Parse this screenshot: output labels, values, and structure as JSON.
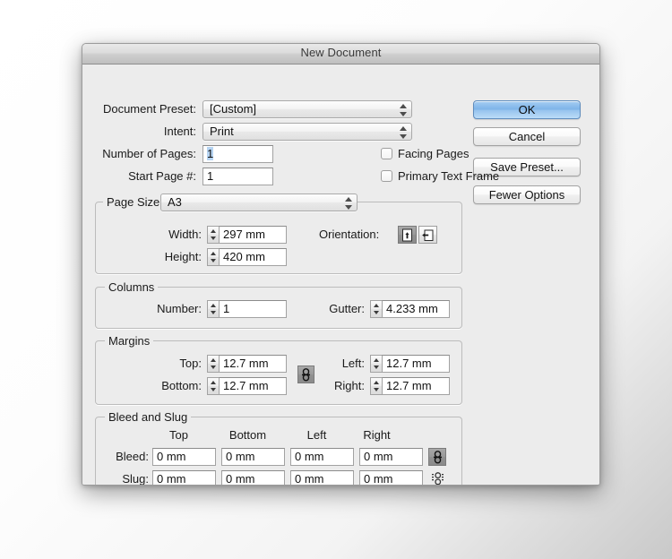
{
  "window": {
    "title": "New Document"
  },
  "buttons": {
    "ok": "OK",
    "cancel": "Cancel",
    "save_preset": "Save Preset...",
    "fewer_options": "Fewer Options"
  },
  "top_fields": {
    "document_preset_label": "Document Preset:",
    "document_preset_value": "[Custom]",
    "intent_label": "Intent:",
    "intent_value": "Print",
    "number_of_pages_label": "Number of Pages:",
    "number_of_pages_value": "1",
    "start_page_label": "Start Page #:",
    "start_page_value": "1",
    "facing_pages_label": "Facing Pages",
    "facing_pages_checked": false,
    "primary_text_frame_label": "Primary Text Frame",
    "primary_text_frame_checked": false
  },
  "page_size": {
    "group_label": "Page Size:",
    "value": "A3",
    "width_label": "Width:",
    "width_value": "297 mm",
    "height_label": "Height:",
    "height_value": "420 mm",
    "orientation_label": "Orientation:",
    "orientation_portrait_icon": "portrait-orientation-icon",
    "orientation_landscape_icon": "landscape-orientation-icon",
    "orientation_selected": "portrait"
  },
  "columns": {
    "group_label": "Columns",
    "number_label": "Number:",
    "number_value": "1",
    "gutter_label": "Gutter:",
    "gutter_value": "4.233 mm"
  },
  "margins": {
    "group_label": "Margins",
    "top_label": "Top:",
    "top_value": "12.7 mm",
    "bottom_label": "Bottom:",
    "bottom_value": "12.7 mm",
    "left_label": "Left:",
    "left_value": "12.7 mm",
    "right_label": "Right:",
    "right_value": "12.7 mm",
    "link_icon": "chain-link-icon",
    "link_active": true
  },
  "bleed_and_slug": {
    "group_label": "Bleed and Slug",
    "col_top": "Top",
    "col_bottom": "Bottom",
    "col_left": "Left",
    "col_right": "Right",
    "bleed_label": "Bleed:",
    "bleed_top": "0 mm",
    "bleed_bottom": "0 mm",
    "bleed_left": "0 mm",
    "bleed_right": "0 mm",
    "bleed_link_icon": "chain-link-icon",
    "slug_label": "Slug:",
    "slug_top": "0 mm",
    "slug_bottom": "0 mm",
    "slug_left": "0 mm",
    "slug_right": "0 mm",
    "slug_link_icon": "chain-link-broken-icon"
  },
  "colors": {
    "dialog_background": "#ececec",
    "default_button_accent": "#7db3e8",
    "selection_highlight": "#b6d4f2",
    "group_border": "#bcbcbc"
  }
}
